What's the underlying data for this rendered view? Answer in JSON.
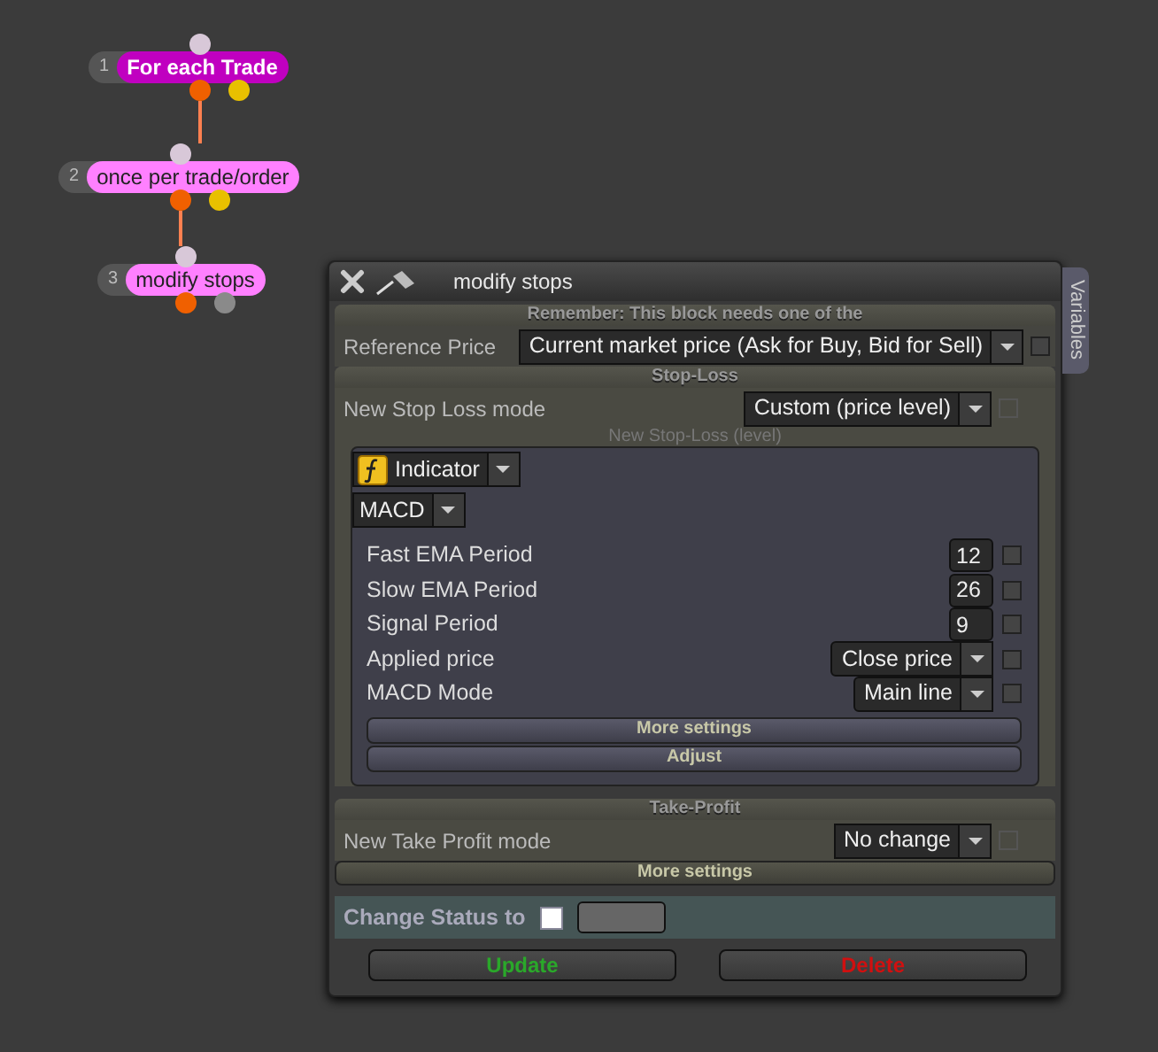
{
  "nodes": [
    {
      "number": "1",
      "label": "For each Trade",
      "selected": true,
      "color": "#e8c000"
    },
    {
      "number": "2",
      "label": "once per trade/order",
      "selected": false,
      "color": "#e8c000"
    },
    {
      "number": "3",
      "label": "modify stops",
      "selected": false,
      "color": "#8a8a8a"
    }
  ],
  "dialog": {
    "title": "modify stops",
    "side_tab": "Variables",
    "note": "Remember: This block needs one of the",
    "reference": {
      "label": "Reference Price",
      "value": "Current market price (Ask for Buy, Bid for Sell)",
      "checked": false,
      "disabled": false
    },
    "stop_loss": {
      "header": "Stop-Loss",
      "label": "New Stop Loss mode",
      "value": "Custom (price level)",
      "checked": false,
      "disabled": true,
      "sub_header": "New Stop-Loss (level)",
      "source": "Indicator",
      "indicator": "MACD",
      "params": [
        {
          "kind": "input",
          "label": "Fast EMA Period",
          "value": "12",
          "checked": false
        },
        {
          "kind": "input",
          "label": "Slow EMA Period",
          "value": "26",
          "checked": false
        },
        {
          "kind": "input",
          "label": "Signal Period",
          "value": "9",
          "checked": false
        },
        {
          "kind": "select",
          "label": "Applied price",
          "value": "Close price",
          "checked": false
        },
        {
          "kind": "select",
          "label": "MACD Mode",
          "value": "Main line",
          "checked": false
        }
      ],
      "buttons": [
        "More settings",
        "Adjust"
      ]
    },
    "take_profit": {
      "header": "Take-Profit",
      "label": "New Take Profit mode",
      "value": "No change",
      "checked": false,
      "disabled": true
    },
    "more_settings": "More settings",
    "status": {
      "label": "Change Status to",
      "checked": false
    },
    "buttons": [
      {
        "label": "Update",
        "kind": "update"
      },
      {
        "label": "Delete",
        "kind": "delete"
      }
    ]
  }
}
